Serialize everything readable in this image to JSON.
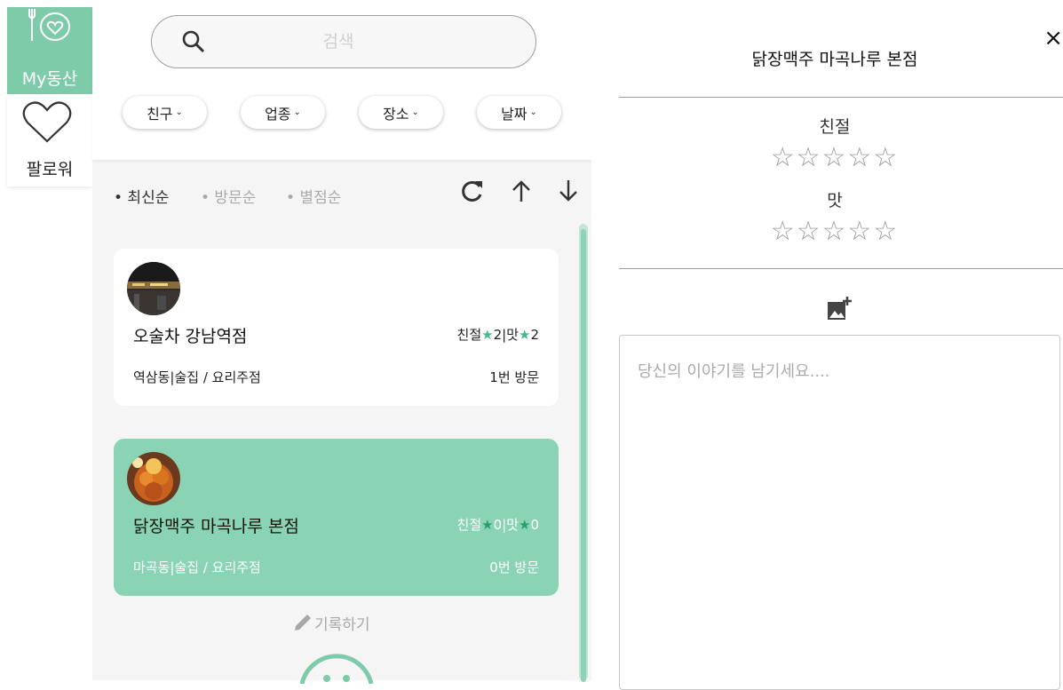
{
  "nav": {
    "active_label": "My동산",
    "follow_label": "팔로워"
  },
  "search": {
    "placeholder": "검색"
  },
  "filters": [
    {
      "label": "친구"
    },
    {
      "label": "업종"
    },
    {
      "label": "장소"
    },
    {
      "label": "날짜"
    }
  ],
  "sort": {
    "options": [
      {
        "label": "• 최신순",
        "active": true
      },
      {
        "label": "• 방문순",
        "active": false
      },
      {
        "label": "• 별점순",
        "active": false
      }
    ],
    "icons": [
      "refresh-icon",
      "arrow-up-icon",
      "arrow-down-icon"
    ]
  },
  "places": [
    {
      "name": "오술차 강남역점",
      "kind_label": "친절",
      "kind_value": "2",
      "taste_label": "맛",
      "taste_value": "2",
      "separator": "|",
      "subtitle": "역삼동|술집 / 요리주점",
      "visits": "1번 방문",
      "selected": false
    },
    {
      "name": "닭장맥주 마곡나루 본점",
      "kind_label": "친절",
      "kind_value": "0",
      "taste_label": "맛",
      "taste_value": "0",
      "separator": "|",
      "subtitle": "마곡동|술집 / 요리주점",
      "visits": "0번 방문",
      "selected": true
    }
  ],
  "write_label": "기록하기",
  "detail": {
    "title": "닭장맥주 마곡나루 본점",
    "close": "×",
    "criteria": [
      {
        "label": "친절",
        "stars": "☆☆☆☆☆"
      },
      {
        "label": "맛",
        "stars": "☆☆☆☆☆"
      }
    ],
    "story_placeholder": "당신의 이야기를 남기세요...."
  },
  "colors": {
    "accent": "#7dcba8",
    "selected_card": "#8ad4b5",
    "star": "#46b989"
  }
}
